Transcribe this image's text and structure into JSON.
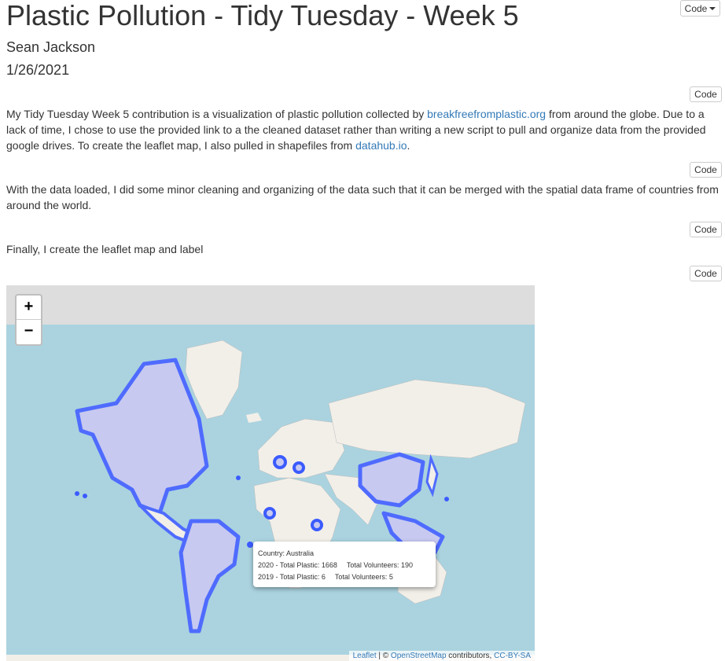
{
  "header": {
    "code_menu_label": "Code",
    "title": "Plastic Pollution - Tidy Tuesday - Week 5",
    "author": "Sean Jackson",
    "date": "1/26/2021"
  },
  "code_buttons": [
    "Code",
    "Code",
    "Code",
    "Code"
  ],
  "para1": {
    "t1": "My Tidy Tuesday Week 5 contribution is a visualization of plastic pollution collected by ",
    "link1": "breakfreefromplastic.org",
    "t2": " from around the globe. Due to a lack of time, I chose to use the provided link to a the cleaned dataset rather than writing a new script to pull and organize data from the provided google drives. To create the leaflet map, I also pulled in shapefiles from ",
    "link2": "datahub.io",
    "t3": "."
  },
  "para2": "With the data loaded, I did some minor cleaning and organizing of the data such that it can be merged with the spatial data frame of countries from around the world.",
  "para3": "Finally, I create the leaflet map and label",
  "map": {
    "zoom_in": "+",
    "zoom_out": "−",
    "popup": {
      "country": "Country: Australia",
      "line2019_plastic": "2019 - Total Plastic: 6",
      "line2019_vol": "Total Volunteers: 5",
      "line2020_plastic": "2020 - Total Plastic: 1668",
      "line2020_vol": "Total Volunteers: 190"
    },
    "attribution": {
      "leaflet": "Leaflet",
      "sep": " | © ",
      "osm": "OpenStreetMap",
      "contrib": " contributors, ",
      "license": "CC-BY-SA"
    },
    "colors": {
      "ocean": "#aad3df",
      "land": "#f2efe9",
      "polar": "#dddddd",
      "highlight": "#3b5bff",
      "highlight_fill": "#c7c9f0"
    }
  }
}
